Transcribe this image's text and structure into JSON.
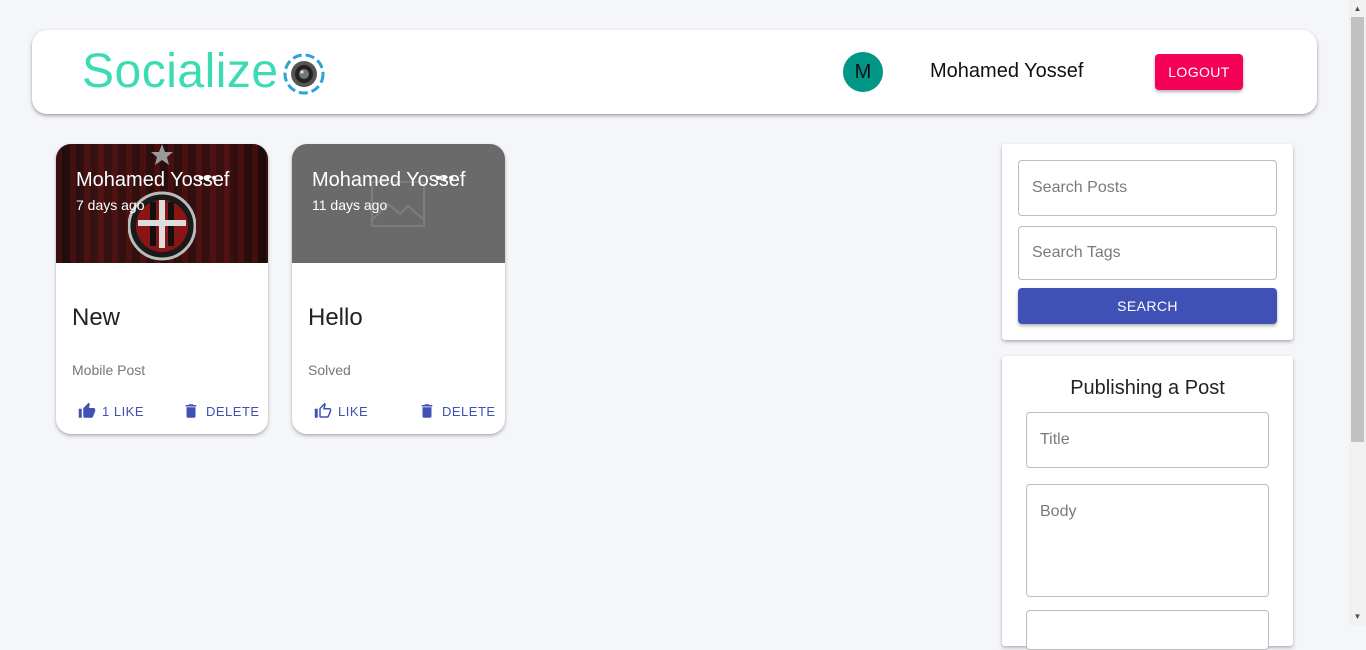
{
  "header": {
    "brand": "Socialize",
    "user": {
      "initial": "M",
      "name": "Mohamed Yossef"
    },
    "logout_label": "LOGOUT"
  },
  "posts": [
    {
      "author": "Mohamed Yossef",
      "time": "7 days ago",
      "title": "New",
      "body": "Mobile Post",
      "like_label": "1 LIKE",
      "delete_label": "DELETE",
      "liked": true
    },
    {
      "author": "Mohamed Yossef",
      "time": "11 days ago",
      "title": "Hello",
      "body": "Solved",
      "like_label": "LIKE",
      "delete_label": "DELETE",
      "liked": false
    }
  ],
  "search": {
    "posts_placeholder": "Search Posts",
    "tags_placeholder": "Search Tags",
    "button_label": "SEARCH"
  },
  "publish": {
    "title": "Publishing a Post",
    "title_placeholder": "Title",
    "body_placeholder": "Body"
  },
  "colors": {
    "brand": "#3ddbb4",
    "avatar": "#009688",
    "logout": "#f50057",
    "primary": "#3f51b5",
    "background": "#f5f6fa"
  },
  "scrollbar": {
    "up_icon": "arrow-up-icon",
    "down_icon": "arrow-down-icon"
  }
}
